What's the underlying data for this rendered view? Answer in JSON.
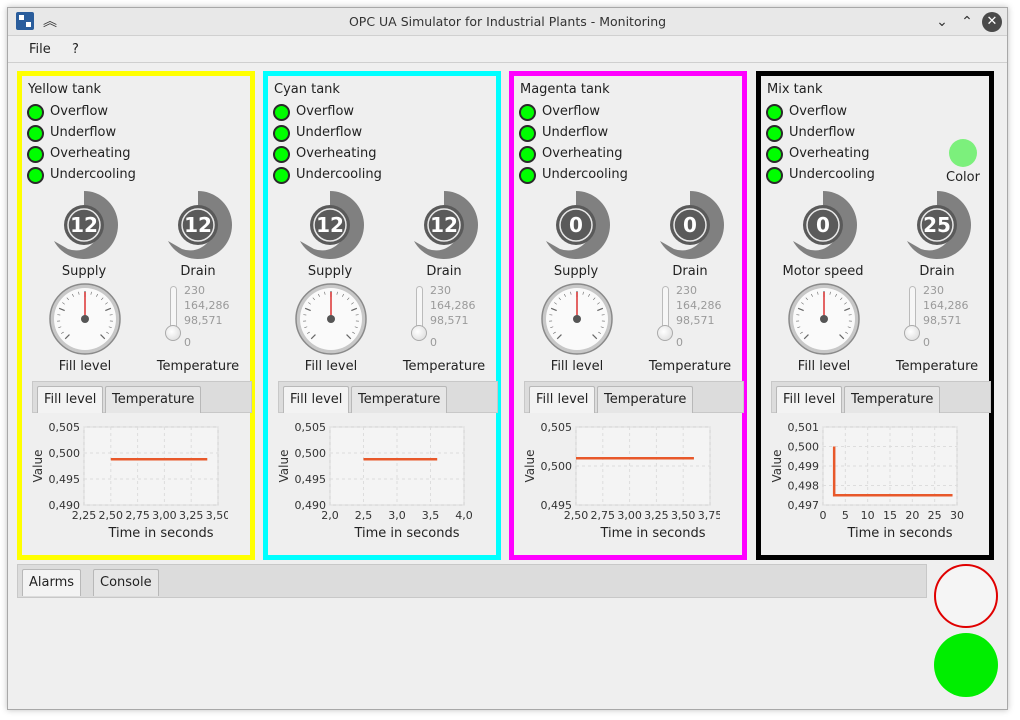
{
  "window": {
    "title": "OPC UA Simulator for Industrial Plants - Monitoring",
    "controls": [
      "minimize",
      "maximize",
      "close"
    ]
  },
  "menu": {
    "file": "File",
    "help": "?"
  },
  "alarm_labels": [
    "Overflow",
    "Underflow",
    "Overheating",
    "Undercooling"
  ],
  "tabs": {
    "fill": "Fill level",
    "temp": "Temperature"
  },
  "panels": [
    {
      "title": "Yellow tank",
      "border_color": "#ffff00",
      "gauge1": {
        "value": "12",
        "label": "Supply"
      },
      "gauge2": {
        "value": "12",
        "label": "Drain"
      },
      "fill_label": "Fill level",
      "temp_label": "Temperature",
      "thermo_ticks": [
        "230",
        "164,286",
        "98,571",
        "0"
      ],
      "chart_data": {
        "type": "line",
        "xlabel": "Time in seconds",
        "ylabel": "Value",
        "xticks": [
          "2,25",
          "2,50",
          "2,75",
          "3,00",
          "3,25",
          "3,50"
        ],
        "yticks": [
          "0,505",
          "0,500",
          "0,495",
          "0,490"
        ],
        "xlim": [
          2.25,
          3.5
        ],
        "ylim": [
          0.49,
          0.505
        ],
        "series": [
          {
            "x": [
              2.5,
              3.4
            ],
            "y": [
              0.4988,
              0.4988
            ]
          }
        ]
      }
    },
    {
      "title": "Cyan tank",
      "border_color": "#00ffff",
      "gauge1": {
        "value": "12",
        "label": "Supply"
      },
      "gauge2": {
        "value": "12",
        "label": "Drain"
      },
      "fill_label": "Fill level",
      "temp_label": "Temperature",
      "thermo_ticks": [
        "230",
        "164,286",
        "98,571",
        "0"
      ],
      "chart_data": {
        "type": "line",
        "xlabel": "Time in seconds",
        "ylabel": "Value",
        "xticks": [
          "2,0",
          "2,5",
          "3,0",
          "3,5",
          "4,0"
        ],
        "yticks": [
          "0,505",
          "0,500",
          "0,495",
          "0,490"
        ],
        "xlim": [
          2.0,
          4.0
        ],
        "ylim": [
          0.49,
          0.505
        ],
        "series": [
          {
            "x": [
              2.5,
              3.6
            ],
            "y": [
              0.4988,
              0.4988
            ]
          }
        ]
      }
    },
    {
      "title": "Magenta tank",
      "border_color": "#ff00ff",
      "gauge1": {
        "value": "0",
        "label": "Supply"
      },
      "gauge2": {
        "value": "0",
        "label": "Drain"
      },
      "fill_label": "Fill level",
      "temp_label": "Temperature",
      "thermo_ticks": [
        "230",
        "164,286",
        "98,571",
        "0"
      ],
      "chart_data": {
        "type": "line",
        "xlabel": "Time in seconds",
        "ylabel": "Value",
        "xticks": [
          "2,50",
          "2,75",
          "3,00",
          "3,25",
          "3,50",
          "3,75"
        ],
        "yticks": [
          "0,505",
          "0,500",
          "0,495"
        ],
        "xlim": [
          2.5,
          3.75
        ],
        "ylim": [
          0.4925,
          0.505
        ],
        "series": [
          {
            "x": [
              2.5,
              3.6
            ],
            "y": [
              0.5,
              0.5
            ]
          }
        ]
      }
    },
    {
      "title": "Mix tank",
      "border_color": "#000000",
      "gauge1": {
        "value": "0",
        "label": "Motor speed"
      },
      "gauge2": {
        "value": "25",
        "label": "Drain"
      },
      "color_label": "Color",
      "color_value": "#7cf07c",
      "fill_label": "Fill level",
      "temp_label": "Temperature",
      "thermo_ticks": [
        "230",
        "164,286",
        "98,571",
        "0"
      ],
      "chart_data": {
        "type": "line",
        "xlabel": "Time in seconds",
        "ylabel": "Value",
        "xticks": [
          "0",
          "5",
          "10",
          "15",
          "20",
          "25",
          "30"
        ],
        "yticks": [
          "0,501",
          "0,500",
          "0,499",
          "0,498",
          "0,497"
        ],
        "xlim": [
          0,
          30
        ],
        "ylim": [
          0.497,
          0.501
        ],
        "series": [
          {
            "x": [
              2.5,
              2.5,
              29
            ],
            "y": [
              0.5,
              0.4975,
              0.4975
            ]
          }
        ]
      }
    }
  ],
  "bottom_tabs": {
    "alarms": "Alarms",
    "console": "Console"
  },
  "colors": {
    "accent_line": "#e8582a",
    "led_on": "#00ff00",
    "gauge": "#7f7f7f",
    "status_red": "#e00000",
    "status_green": "#00ee00"
  }
}
